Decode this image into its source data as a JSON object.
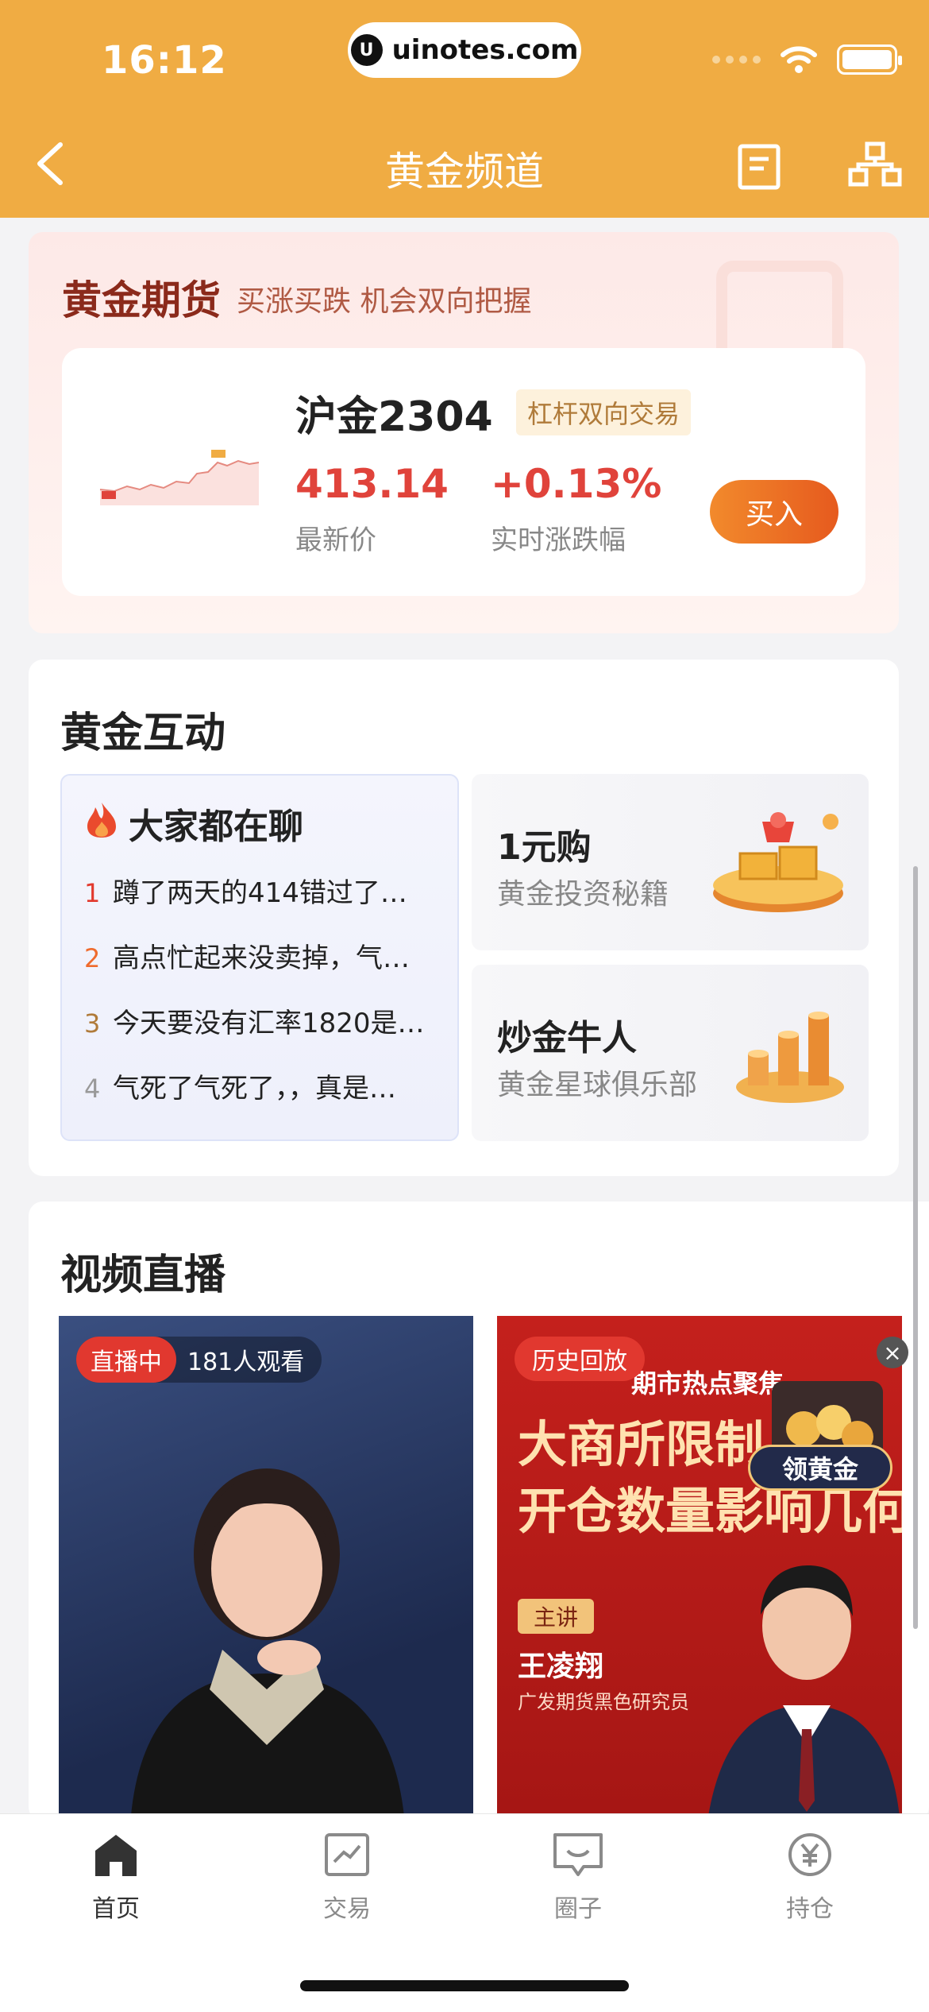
{
  "status_bar": {
    "time": "16:12",
    "url": "uinotes.com"
  },
  "nav": {
    "title": "黄金频道",
    "back_icon": "chevron-left-icon",
    "doc_icon": "document-icon",
    "share_icon": "hierarchy-icon"
  },
  "futures": {
    "title": "黄金期货",
    "subtitle": "买涨买跌 机会双向把握",
    "contract": "沪金2304",
    "tag": "杠杆双向交易",
    "price": "413.14",
    "price_label": "最新价",
    "change": "+0.13%",
    "change_label": "实时涨跌幅",
    "buy_label": "买入",
    "colors": {
      "up": "#e0433b"
    }
  },
  "interact": {
    "title": "黄金互动",
    "chat": {
      "title": "大家都在聊",
      "items": [
        {
          "rank": "1",
          "text": "蹲了两天的414错过了…"
        },
        {
          "rank": "2",
          "text": "高点忙起来没卖掉，气…"
        },
        {
          "rank": "3",
          "text": "今天要没有汇率1820是…"
        },
        {
          "rank": "4",
          "text": "气死了气死了，，真是…"
        }
      ]
    },
    "promos": [
      {
        "title": "1元购",
        "subtitle": "黄金投资秘籍",
        "icon": "gold-bars-gift-icon"
      },
      {
        "title": "炒金牛人",
        "subtitle": "黄金星球俱乐部",
        "icon": "gold-coin-stack-icon"
      }
    ]
  },
  "video": {
    "title": "视频直播",
    "live": {
      "badge": "直播中",
      "viewers": "181人观看"
    },
    "replay": {
      "badge": "历史回放",
      "strip": "期市热点聚焦",
      "headline_1": "大商所限制",
      "headline_2": "开仓数量影响几何",
      "speaker_tag": "主讲",
      "speaker_name": "王凌翔",
      "speaker_title": "广发期货黑色研究员"
    },
    "float_button": "领黄金"
  },
  "tabs": [
    {
      "label": "首页",
      "icon": "home-icon",
      "active": true
    },
    {
      "label": "交易",
      "icon": "chart-trend-icon",
      "active": false
    },
    {
      "label": "圈子",
      "icon": "chat-bubble-icon",
      "active": false
    },
    {
      "label": "持仓",
      "icon": "yen-icon",
      "active": false
    }
  ]
}
